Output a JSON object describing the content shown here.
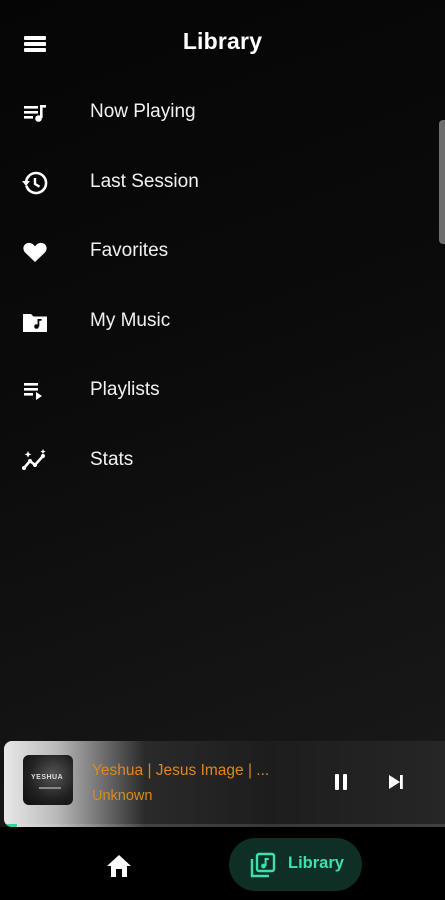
{
  "header": {
    "title": "Library",
    "menu_icon": "menu-icon"
  },
  "nav": {
    "items": [
      {
        "label": "Now Playing",
        "icon": "queue-music-icon"
      },
      {
        "label": "Last Session",
        "icon": "history-icon"
      },
      {
        "label": "Favorites",
        "icon": "heart-icon"
      },
      {
        "label": "My Music",
        "icon": "music-folder-icon"
      },
      {
        "label": "Playlists",
        "icon": "playlist-play-icon"
      },
      {
        "label": "Stats",
        "icon": "insights-icon"
      }
    ]
  },
  "player": {
    "title": "Yeshua | Jesus Image | ...",
    "artist": "Unknown",
    "art_text": "YESHUA",
    "progress": 0.03,
    "accent_color": "#e0881b"
  },
  "bottom_nav": {
    "home_icon": "home-icon",
    "library_label": "Library",
    "library_icon": "library-music-icon",
    "active_color": "#3fe0ad",
    "active_bg": "#0f2e26"
  }
}
